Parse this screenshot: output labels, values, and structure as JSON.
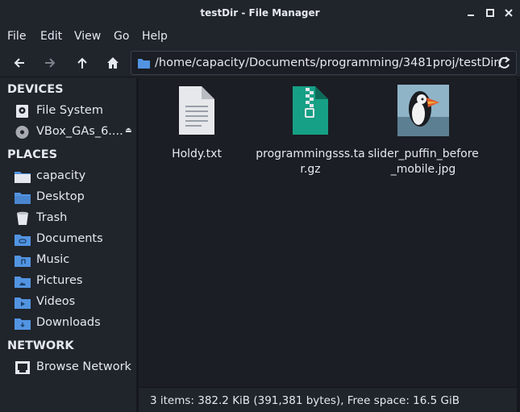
{
  "window": {
    "title": "testDir - File Manager"
  },
  "menubar": {
    "items": [
      "File",
      "Edit",
      "View",
      "Go",
      "Help"
    ]
  },
  "toolbar": {
    "path": "/home/capacity/Documents/programming/3481proj/testDir/"
  },
  "sidebar": {
    "devices_title": "DEVICES",
    "devices": [
      {
        "label": "File System",
        "icon": "harddisk-icon"
      },
      {
        "label": "VBox_GAs_6....",
        "icon": "optical-disc-icon"
      }
    ],
    "places_title": "PLACES",
    "places": [
      {
        "label": "capacity",
        "icon": "home-folder-icon"
      },
      {
        "label": "Desktop",
        "icon": "desktop-folder-icon"
      },
      {
        "label": "Trash",
        "icon": "trash-icon"
      },
      {
        "label": "Documents",
        "icon": "documents-folder-icon"
      },
      {
        "label": "Music",
        "icon": "music-folder-icon"
      },
      {
        "label": "Pictures",
        "icon": "pictures-folder-icon"
      },
      {
        "label": "Videos",
        "icon": "videos-folder-icon"
      },
      {
        "label": "Downloads",
        "icon": "downloads-folder-icon"
      }
    ],
    "network_title": "NETWORK",
    "network": [
      {
        "label": "Browse Network",
        "icon": "network-icon"
      }
    ]
  },
  "files": [
    {
      "name": "Holdy.txt",
      "icon": "text-file-icon"
    },
    {
      "name": "programmingsss.tar.gz",
      "icon": "archive-file-icon"
    },
    {
      "name": "slider_puffin_before_mobile.jpg",
      "icon": "image-thumbnail-icon"
    }
  ],
  "status": {
    "text": "3 items: 382.2 KiB (391,381 bytes), Free space: 16.5 GiB"
  },
  "colors": {
    "accent": "#5294e2",
    "archive": "#16a085",
    "background": "#1b1e24",
    "panel": "#20242b"
  }
}
